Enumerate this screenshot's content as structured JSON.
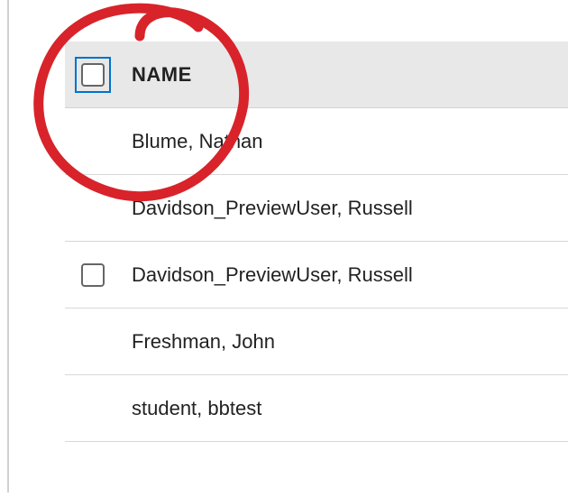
{
  "table": {
    "header": {
      "name_col": "NAME"
    },
    "rows": [
      {
        "name": "Blume, Nathan",
        "show_checkbox": false
      },
      {
        "name": "Davidson_PreviewUser, Russell",
        "show_checkbox": false
      },
      {
        "name": "Davidson_PreviewUser, Russell",
        "show_checkbox": true
      },
      {
        "name": "Freshman, John",
        "show_checkbox": false
      },
      {
        "name": "student, bbtest",
        "show_checkbox": false
      }
    ]
  },
  "annotation": {
    "color": "#d8232a"
  }
}
